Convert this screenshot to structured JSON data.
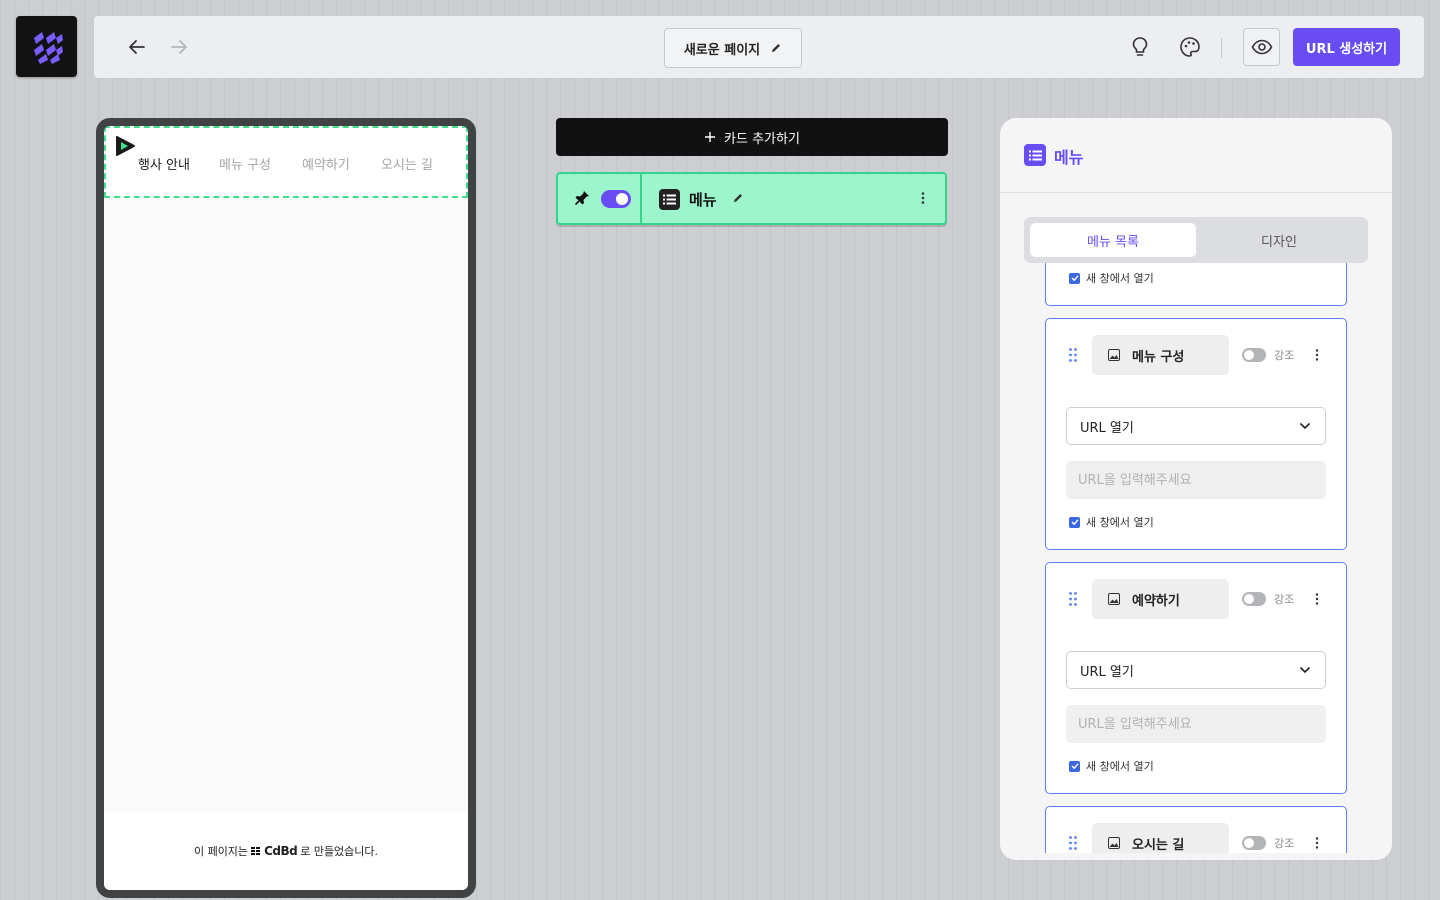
{
  "header": {
    "page_name": "새로운 페이지",
    "url_button": "URL 생성하기"
  },
  "preview": {
    "tabs": [
      "행사 안내",
      "메뉴 구성",
      "예약하기",
      "오시는 길"
    ],
    "footer_prefix": "이 페이지는",
    "footer_brand": "CdBd",
    "footer_suffix": "로 만들었습니다."
  },
  "editor": {
    "add_card_label": "카드 추가하기",
    "card_title": "메뉴"
  },
  "panel": {
    "title": "메뉴",
    "tabs": {
      "list": "메뉴 목록",
      "design": "디자인"
    },
    "new_window_label": "새 창에서 열기",
    "emphasis_label": "강조",
    "items": [
      {
        "name": "메뉴 구성",
        "action": "URL 열기",
        "url_placeholder": "URL을 입력해주세요",
        "new_window": true
      },
      {
        "name": "예약하기",
        "action": "URL 열기",
        "url_placeholder": "URL을 입력해주세요",
        "new_window": true
      },
      {
        "name": "오시는 길"
      }
    ]
  },
  "colors": {
    "accent": "#6a4cf5",
    "card_bg": "#9cf5cd",
    "card_border": "#34d58a",
    "item_border": "#5b83f0"
  }
}
